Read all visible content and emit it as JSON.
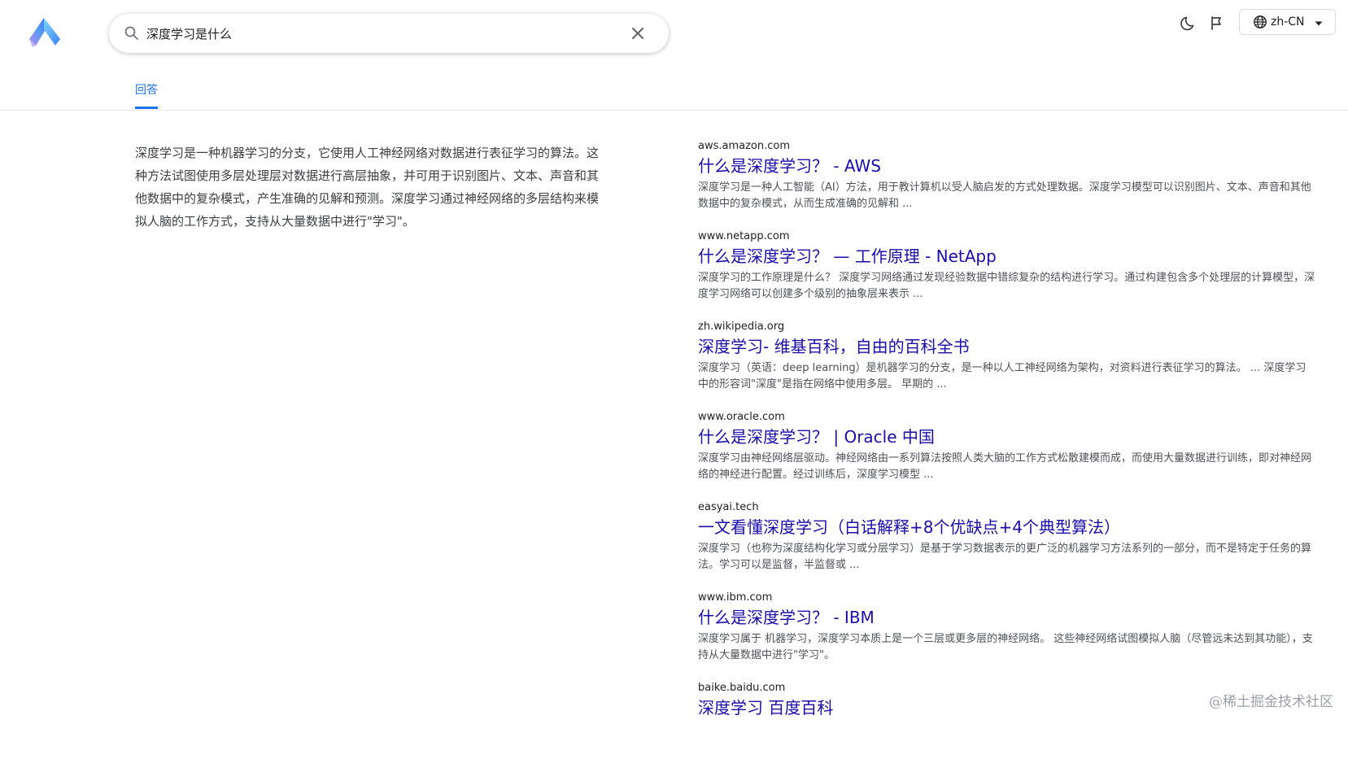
{
  "search": {
    "query": "深度学习是什么",
    "placeholder": ""
  },
  "header": {
    "language": "zh-CN"
  },
  "tabs": [
    {
      "label": "回答",
      "active": true
    }
  ],
  "answer": {
    "text": "深度学习是一种机器学习的分支，它使用人工神经网络对数据进行表征学习的算法。这种方法试图使用多层处理层对数据进行高层抽象，并可用于识别图片、文本、声音和其他数据中的复杂模式，产生准确的见解和预测。深度学习通过神经网络的多层结构来模拟人脑的工作方式，支持从大量数据中进行\"学习\"。"
  },
  "results": [
    {
      "domain": "aws.amazon.com",
      "title": "什么是深度学习？ - AWS",
      "snippet": "深度学习是一种人工智能（AI）方法，用于教计算机以受人脑启发的方式处理数据。深度学习模型可以识别图片、文本、声音和其他数据中的复杂模式，从而生成准确的见解和 ..."
    },
    {
      "domain": "www.netapp.com",
      "title": "什么是深度学习？ — 工作原理 - NetApp",
      "snippet": "深度学习的工作原理是什么？ 深度学习网络通过发现经验数据中错综复杂的结构进行学习。通过构建包含多个处理层的计算模型，深度学习网络可以创建多个级别的抽象层来表示 ..."
    },
    {
      "domain": "zh.wikipedia.org",
      "title": "深度学习- 维基百科，自由的百科全书",
      "snippet": "深度学习（英语：deep learning）是机器学习的分支，是一种以人工神经网络为架构，对资料进行表征学习的算法。 ... 深度学习中的形容词\"深度\"是指在网络中使用多层。 早期的 ..."
    },
    {
      "domain": "www.oracle.com",
      "title": "什么是深度学习？ | Oracle 中国",
      "snippet": "深度学习由神经网络层驱动。神经网络由一系列算法按照人类大脑的工作方式松散建模而成，而使用大量数据进行训练，即对神经网络的神经进行配置。经过训练后，深度学习模型 ..."
    },
    {
      "domain": "easyai.tech",
      "title": "一文看懂深度学习（白话解释+8个优缺点+4个典型算法）",
      "snippet": "深度学习（也称为深度结构化学习或分层学习）是基于学习数据表示的更广泛的机器学习方法系列的一部分，而不是特定于任务的算法。学习可以是监督，半监督或 ..."
    },
    {
      "domain": "www.ibm.com",
      "title": "什么是深度学习？ - IBM",
      "snippet": "深度学习属于 机器学习，深度学习本质上是一个三层或更多层的神经网络。 这些神经网络试图模拟人脑（尽管远未达到其功能），支持从大量数据中进行\"学习\"。"
    },
    {
      "domain": "baike.baidu.com",
      "title": "深度学习 百度百科",
      "snippet": ""
    }
  ],
  "watermark": "@稀土掘金技术社区",
  "colors": {
    "accent": "#1a73e8",
    "link": "#1a0dab",
    "snippet": "#4d5156"
  },
  "icons": [
    "logo-icon",
    "search-icon",
    "close-icon",
    "moon-icon",
    "flag-icon",
    "globe-icon",
    "caret-down-icon"
  ]
}
